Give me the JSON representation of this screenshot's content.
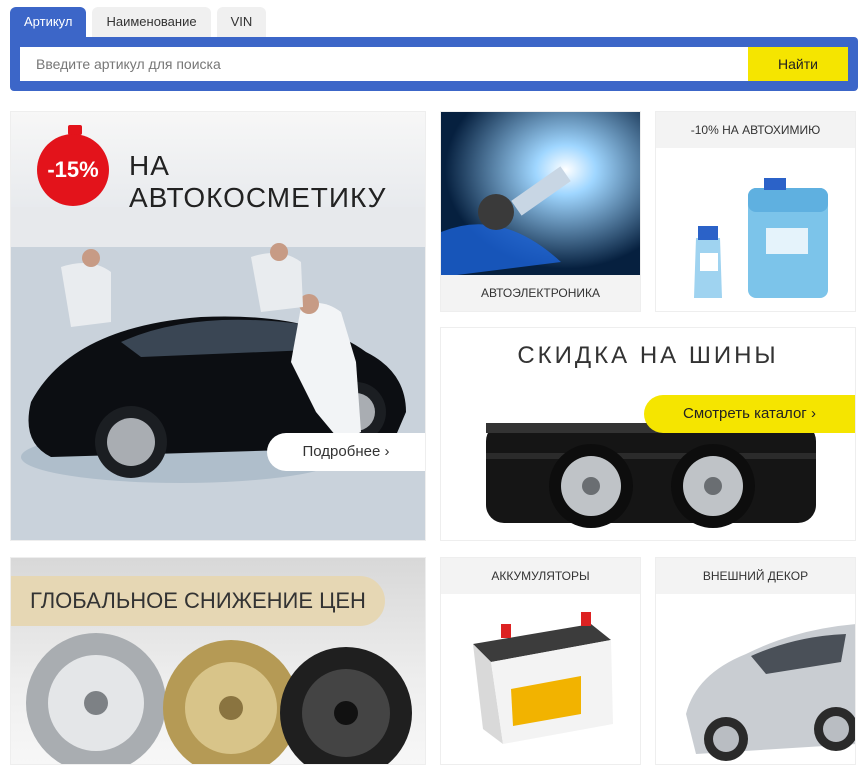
{
  "search": {
    "tabs": [
      "Артикул",
      "Наименование",
      "VIN"
    ],
    "placeholder": "Введите артикул для поиска",
    "button": "Найти"
  },
  "promo": {
    "badge": "-15%",
    "title": "НА АВТОКОСМЕТИКУ",
    "more_button": "Подробнее ›"
  },
  "tiles": {
    "electronics": "АВТОЭЛЕКТРОНИКА",
    "chemistry": "-10% НА АВТОХИМИЮ",
    "tires_title": "СКИДКА НА ШИНЫ",
    "catalog_button": "Смотреть каталог ›",
    "wheels": "ГЛОБАЛЬНОЕ СНИЖЕНИЕ ЦЕН",
    "batteries": "АККУМУЛЯТОРЫ",
    "decor": "ВНЕШНИЙ ДЕКОР"
  },
  "colors": {
    "accent": "#3c66c8",
    "button": "#f5e500",
    "discount": "#e3131b"
  }
}
